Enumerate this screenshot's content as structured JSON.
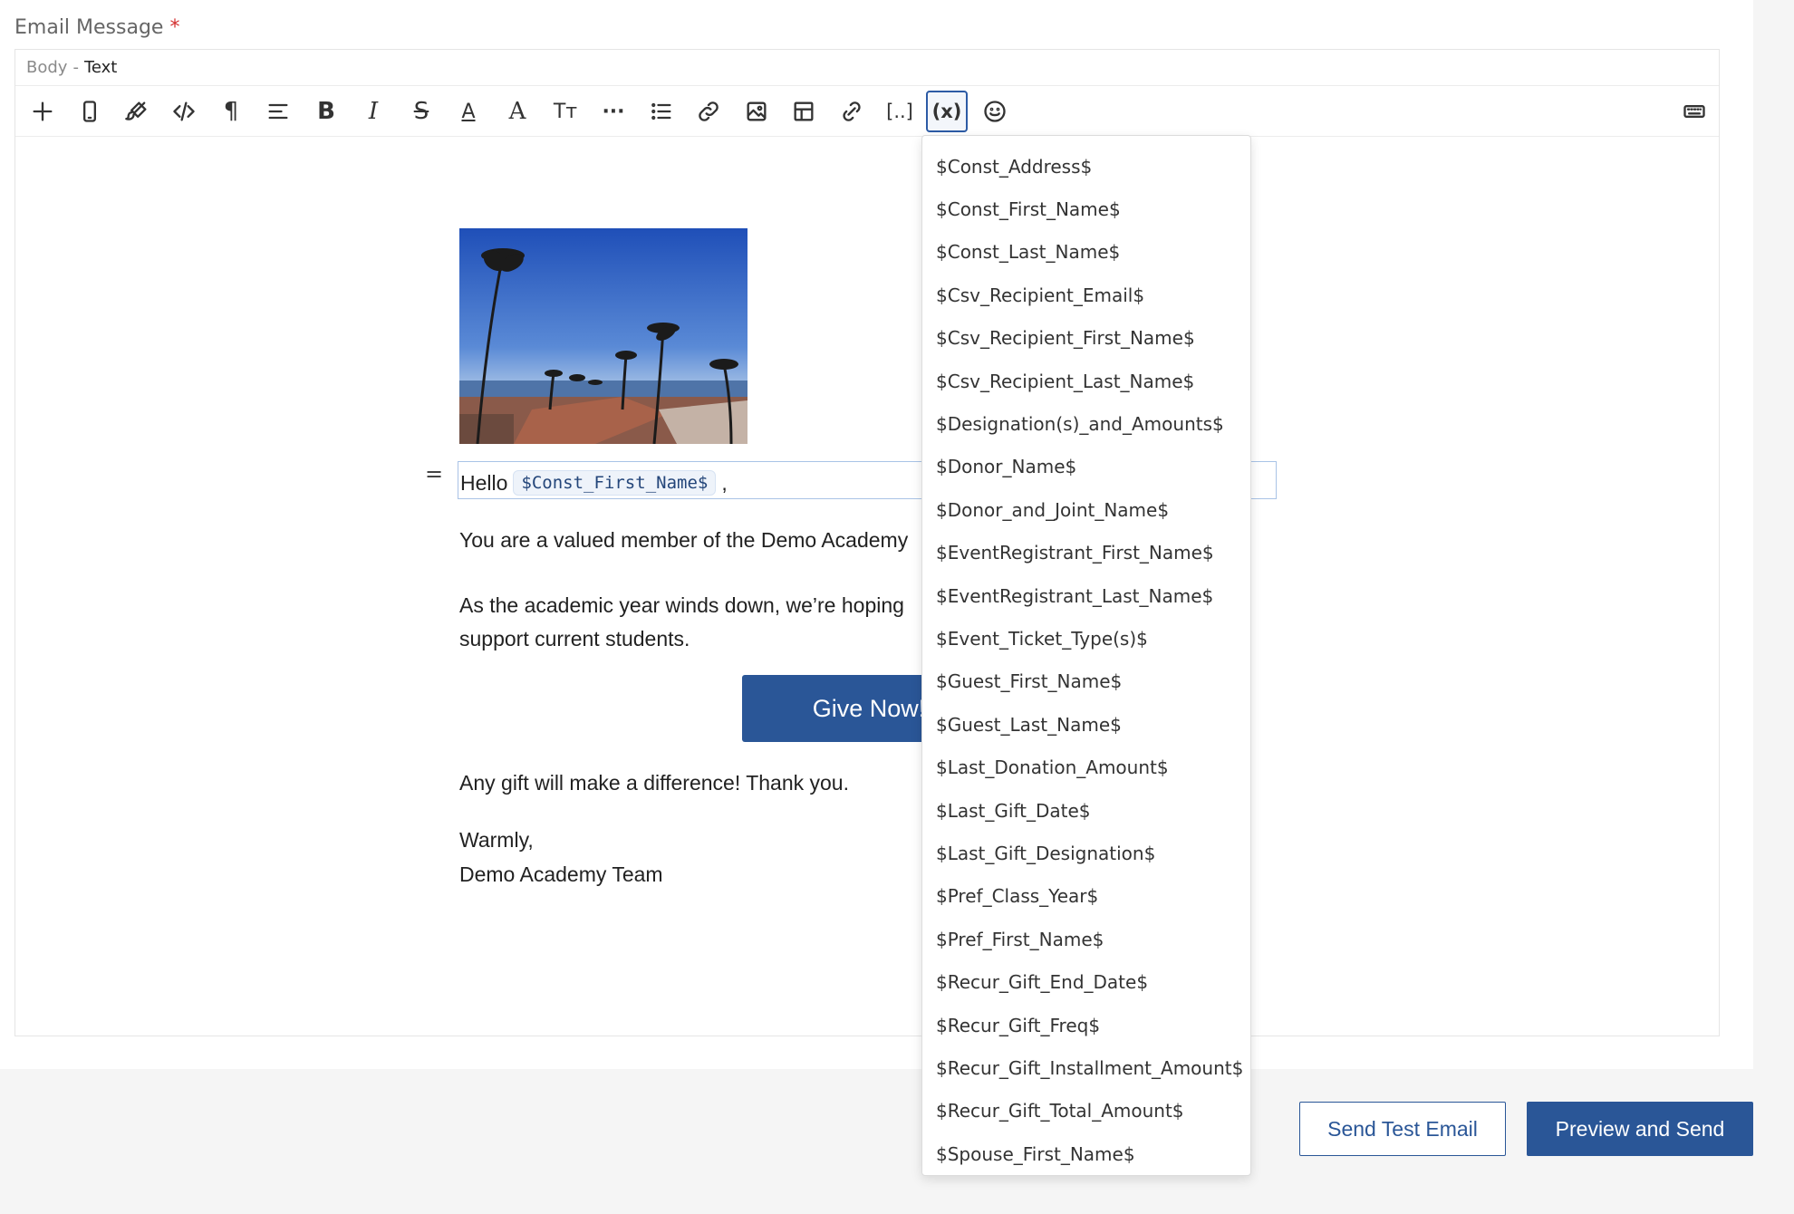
{
  "field": {
    "label": "Email Message",
    "required_mark": "*"
  },
  "mode_bar": {
    "body_label": "Body",
    "separator": "-",
    "mode": "Text"
  },
  "toolbar": {
    "paragraph_glyph": "¶",
    "bold_glyph": "B",
    "italic_glyph": "I",
    "strike_glyph": "S",
    "font_glyph": "A",
    "size_glyph": "Tт",
    "more_glyph": "···",
    "variable_glyph": "(x)",
    "special_glyph": "[..]"
  },
  "email": {
    "greeting": "Hello",
    "greeting_token": "$Const_First_Name$",
    "greeting_suffix": ",",
    "drag_handle": "=",
    "para1": "You are a valued member of the Demo Academy",
    "para2_line1": "As the academic year winds down, we’re hoping",
    "para2_line2": "support current students.",
    "cta_label": "Give Now!",
    "para3": "Any gift will make a difference! Thank you.",
    "signoff_line1": "Warmly,",
    "signoff_line2": "Demo Academy Team"
  },
  "variables_dropdown": {
    "options": [
      "$Const_Address$",
      "$Const_First_Name$",
      "$Const_Last_Name$",
      "$Csv_Recipient_Email$",
      "$Csv_Recipient_First_Name$",
      "$Csv_Recipient_Last_Name$",
      "$Designation(s)_and_Amounts$",
      "$Donor_Name$",
      "$Donor_and_Joint_Name$",
      "$EventRegistrant_First_Name$",
      "$EventRegistrant_Last_Name$",
      "$Event_Ticket_Type(s)$",
      "$Guest_First_Name$",
      "$Guest_Last_Name$",
      "$Last_Donation_Amount$",
      "$Last_Gift_Date$",
      "$Last_Gift_Designation$",
      "$Pref_Class_Year$",
      "$Pref_First_Name$",
      "$Recur_Gift_End_Date$",
      "$Recur_Gift_Freq$",
      "$Recur_Gift_Installment_Amount$",
      "$Recur_Gift_Total_Amount$",
      "$Spouse_First_Name$"
    ]
  },
  "footer": {
    "test_button": "Send Test Email",
    "send_button": "Preview and Send"
  },
  "colors": {
    "brand": "#2a5697",
    "required": "#d32f2f",
    "active_border": "#2d5ba5"
  }
}
